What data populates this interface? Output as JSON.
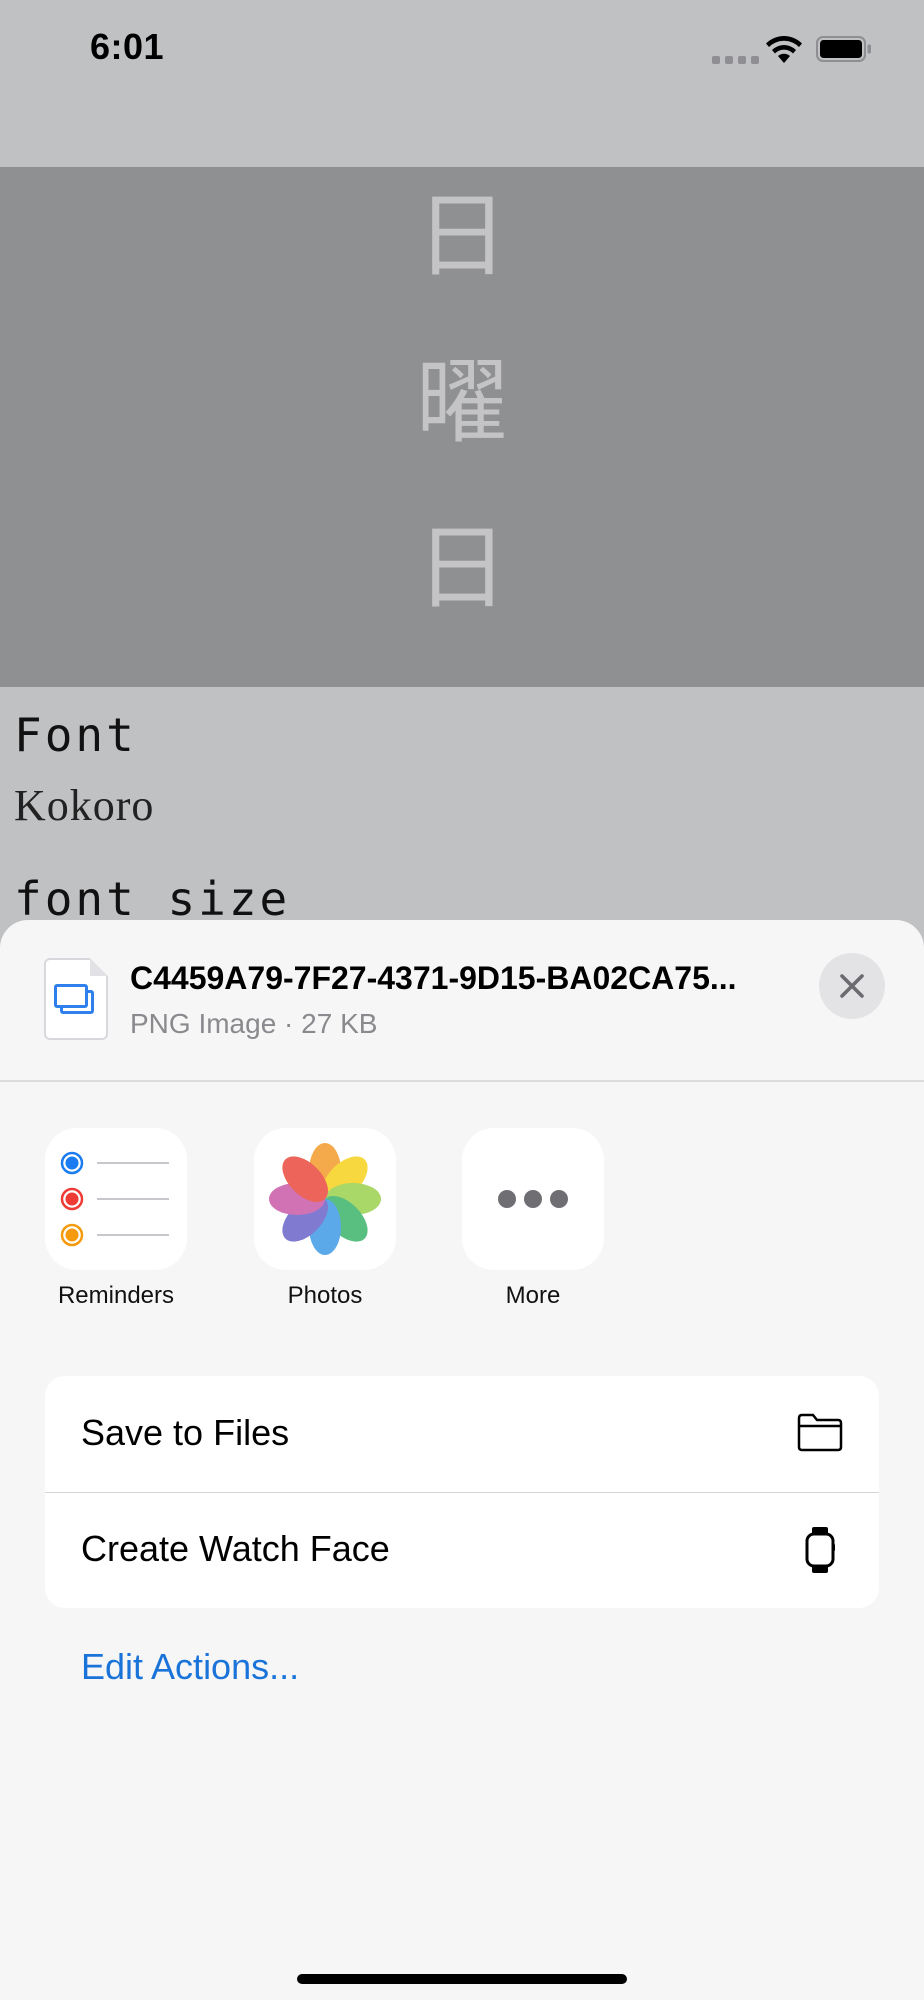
{
  "status_bar": {
    "time": "6:01"
  },
  "preview": {
    "vertical_text": [
      "日",
      "曜",
      "日"
    ]
  },
  "content": {
    "font_label": "Font",
    "font_value": "Kokoro",
    "size_label": "font size"
  },
  "share_sheet": {
    "file_name": "C4459A79-7F27-4371-9D15-BA02CA75...",
    "file_meta": "PNG Image · 27 KB",
    "apps": [
      {
        "label": "Reminders",
        "icon": "reminders-icon"
      },
      {
        "label": "Photos",
        "icon": "photos-icon"
      },
      {
        "label": "More",
        "icon": "more-icon"
      }
    ],
    "actions": [
      {
        "label": "Save to Files",
        "icon": "folder-icon"
      },
      {
        "label": "Create Watch Face",
        "icon": "watch-icon"
      }
    ],
    "edit_actions": "Edit Actions..."
  },
  "colors": {
    "accent": "#1a73d9",
    "reminders_blue": "#1a7cf0",
    "reminders_red": "#ef3b36",
    "reminders_orange": "#f59a0c"
  }
}
